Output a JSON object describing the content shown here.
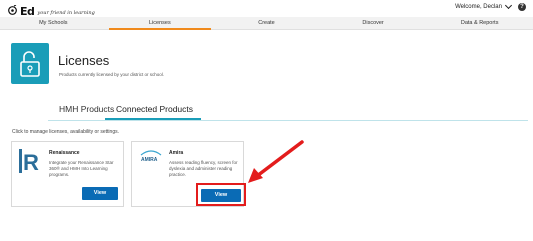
{
  "header": {
    "logo_text": "Ed",
    "tagline": "your friend in learning",
    "welcome": "Welcome, Declan",
    "help_label": "?"
  },
  "nav": {
    "items": [
      {
        "label": "My Schools"
      },
      {
        "label": "Licenses"
      },
      {
        "label": "Create"
      },
      {
        "label": "Discover"
      },
      {
        "label": "Data & Reports"
      }
    ],
    "active_index": 1,
    "active_color": "#f08a1c"
  },
  "page": {
    "title": "Licenses",
    "subtitle": "Products currently licensed by your district or school.",
    "icon": "unlock-icon",
    "icon_bg": "#1a9db8"
  },
  "tabs": {
    "items": [
      {
        "label": "HMH Products"
      },
      {
        "label": "Connected Products"
      }
    ],
    "active_index": 1
  },
  "hint": "Click to manage licenses, availability or settings.",
  "cards": [
    {
      "name": "Renaissance",
      "description": "Integrate your Renaissance Star 360® and HMH Into Learning programs.",
      "button": "View",
      "logo": "renaissance-r-icon"
    },
    {
      "name": "Amira",
      "description": "Assess reading fluency, screen for dyslexia and administer reading practice.",
      "button": "View",
      "logo": "amira-logo-icon",
      "logo_text": "AMIRA"
    }
  ],
  "annotation": {
    "color": "#e31c1c",
    "target": "amira-view-button"
  },
  "colors": {
    "primary_button": "#0a6bb5",
    "accent": "#1a9db8"
  }
}
